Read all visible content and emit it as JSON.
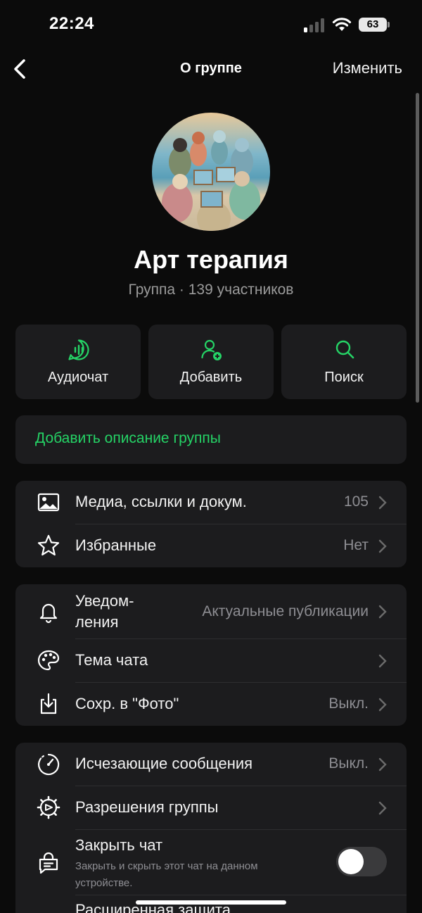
{
  "status_bar": {
    "time": "22:24",
    "battery": "63"
  },
  "nav": {
    "title": "О группе",
    "edit": "Изменить"
  },
  "group": {
    "name": "Арт терапия",
    "subtitle": "Группа · 139 участников"
  },
  "actions": [
    {
      "label": "Аудиочат",
      "icon": "voice-chat-icon"
    },
    {
      "label": "Добавить",
      "icon": "add-person-icon"
    },
    {
      "label": "Поиск",
      "icon": "search-icon"
    }
  ],
  "description": {
    "add_label": "Добавить описание группы"
  },
  "section1": {
    "media": {
      "label": "Медиа, ссылки и докум.",
      "value": "105"
    },
    "starred": {
      "label": "Избранные",
      "value": "Нет"
    }
  },
  "section2": {
    "notifications": {
      "label_line1": "Уведом-",
      "label_line2": "ления",
      "value": "Актуальные публикации"
    },
    "theme": {
      "label": "Тема чата"
    },
    "save_photos": {
      "label": "Сохр. в \"Фото\"",
      "value": "Выкл."
    }
  },
  "section3": {
    "disappearing": {
      "label": "Исчезающие сообщения",
      "value": "Выкл."
    },
    "permissions": {
      "label": "Разрешения группы"
    },
    "lock": {
      "label": "Закрыть чат",
      "sub_line1": "Закрыть и скрыть этот чат на данном",
      "sub_line2": "устройстве.",
      "toggle_on": false
    },
    "advanced": {
      "label": "Расширенная защита"
    }
  },
  "colors": {
    "accent": "#25d366",
    "card": "#1c1c1e",
    "background": "#0b0b0b"
  }
}
